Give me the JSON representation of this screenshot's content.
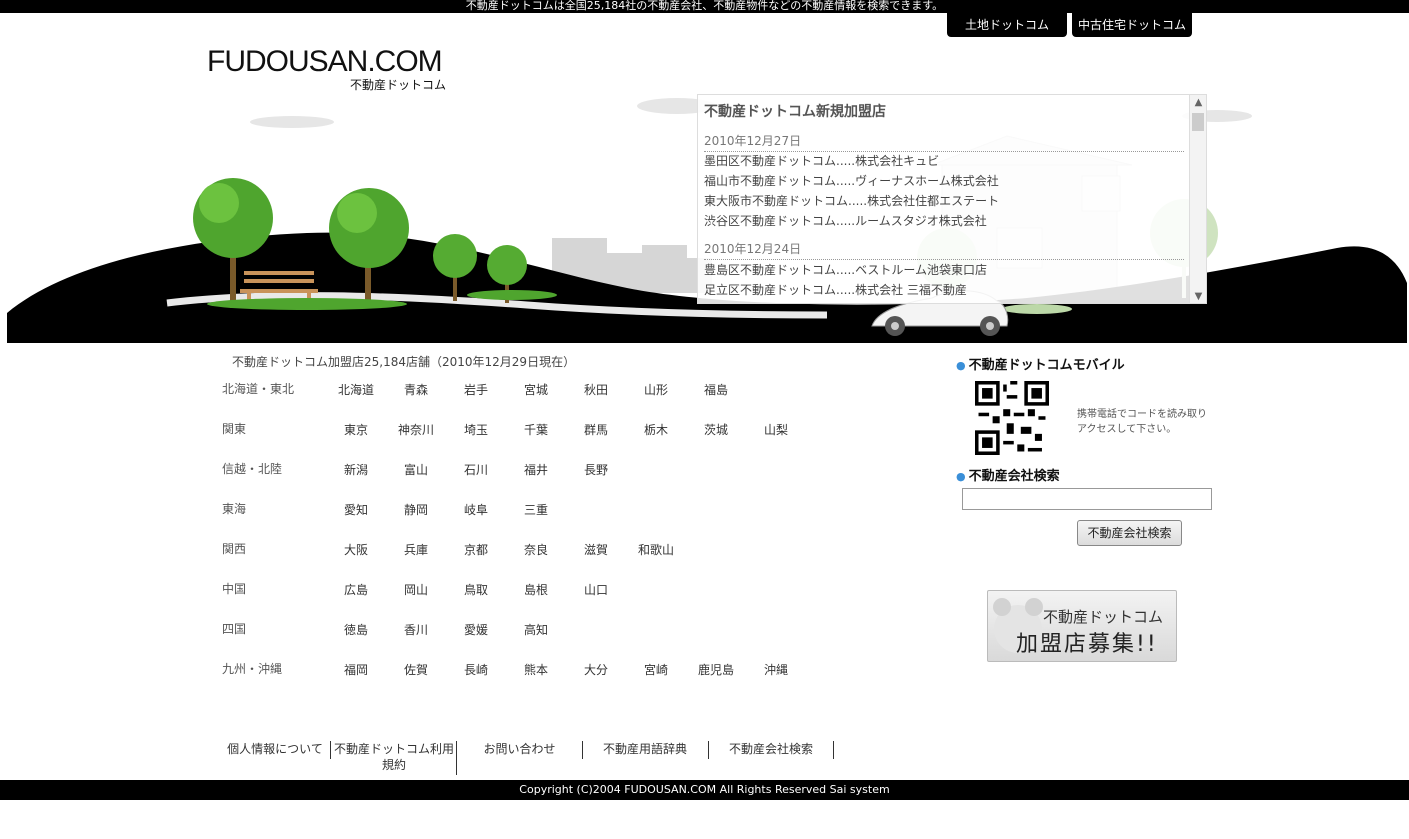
{
  "top_banner_text": "不動産ドットコムは全国25,184社の不動産会社、不動産物件などの不動産情報を検索できます。",
  "top_tabs": [
    "土地ドットコム",
    "中古住宅ドットコム"
  ],
  "logo": {
    "main": "FUDOUSAN.COM",
    "sub": "不動産ドットコム"
  },
  "news": {
    "title": "不動産ドットコム新規加盟店",
    "groups": [
      {
        "date": "2010年12月27日",
        "items": [
          "墨田区不動産ドットコム.....株式会社キュビ",
          "福山市不動産ドットコム.....ヴィーナスホーム株式会社",
          "東大阪市不動産ドットコム.....株式会社住都エステート",
          "渋谷区不動産ドットコム.....ルームスタジオ株式会社"
        ]
      },
      {
        "date": "2010年12月24日",
        "items": [
          "豊島区不動産ドットコム.....ベストルーム池袋東口店",
          "足立区不動産ドットコム.....株式会社 三福不動産"
        ]
      }
    ]
  },
  "member_count": "不動産ドットコム加盟店25,184店舗（2010年12月29日現在）",
  "regions": [
    {
      "name": "北海道・東北",
      "prefs": [
        "北海道",
        "青森",
        "岩手",
        "宮城",
        "秋田",
        "山形",
        "福島"
      ]
    },
    {
      "name": "関東",
      "prefs": [
        "東京",
        "神奈川",
        "埼玉",
        "千葉",
        "群馬",
        "栃木",
        "茨城",
        "山梨"
      ]
    },
    {
      "name": "信越・北陸",
      "prefs": [
        "新潟",
        "富山",
        "石川",
        "福井",
        "長野"
      ]
    },
    {
      "name": "東海",
      "prefs": [
        "愛知",
        "静岡",
        "岐阜",
        "三重"
      ]
    },
    {
      "name": "関西",
      "prefs": [
        "大阪",
        "兵庫",
        "京都",
        "奈良",
        "滋賀",
        "和歌山"
      ]
    },
    {
      "name": "中国",
      "prefs": [
        "広島",
        "岡山",
        "鳥取",
        "島根",
        "山口"
      ]
    },
    {
      "name": "四国",
      "prefs": [
        "徳島",
        "香川",
        "愛媛",
        "高知"
      ]
    },
    {
      "name": "九州・沖縄",
      "prefs": [
        "福岡",
        "佐賀",
        "長崎",
        "熊本",
        "大分",
        "宮崎",
        "鹿児島",
        "沖縄"
      ]
    }
  ],
  "sidebar": {
    "mobile_title": "不動産ドットコムモバイル",
    "mobile_note_1": "携帯電話でコードを読み取り",
    "mobile_note_2": "アクセスして下さい。",
    "search_title": "不動産会社検索",
    "search_value": "",
    "search_button": "不動産会社検索",
    "banner_line1": "不動産ドットコム",
    "banner_line2": "加盟店募集!!"
  },
  "footer_links": [
    "個人情報について",
    "不動産ドットコム利用規約",
    "お問い合わせ",
    "不動産用語辞典",
    "不動産会社検索"
  ],
  "copyright": "Copyright (C)2004 FUDOUSAN.COM All Rights Reserved Sai system"
}
